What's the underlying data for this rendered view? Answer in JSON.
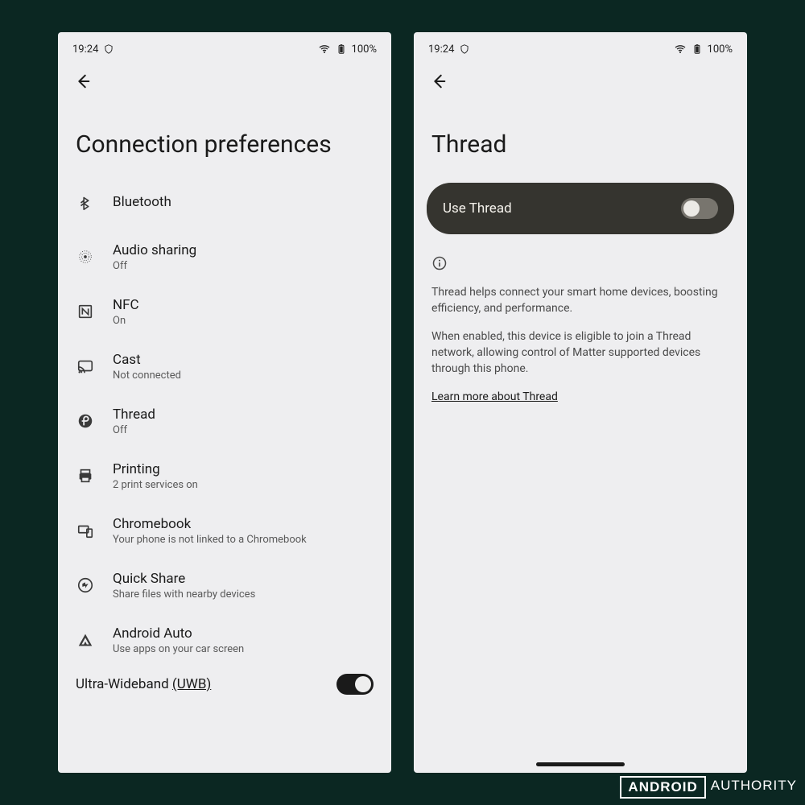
{
  "status": {
    "time": "19:24",
    "battery": "100%"
  },
  "left": {
    "title": "Connection preferences",
    "items": [
      {
        "id": "bluetooth",
        "label": "Bluetooth",
        "sub": ""
      },
      {
        "id": "audio",
        "label": "Audio sharing",
        "sub": "Off"
      },
      {
        "id": "nfc",
        "label": "NFC",
        "sub": "On"
      },
      {
        "id": "cast",
        "label": "Cast",
        "sub": "Not connected"
      },
      {
        "id": "thread",
        "label": "Thread",
        "sub": "Off"
      },
      {
        "id": "printing",
        "label": "Printing",
        "sub": "2 print services on"
      },
      {
        "id": "chromebook",
        "label": "Chromebook",
        "sub": "Your phone is not linked to a Chromebook"
      },
      {
        "id": "quickshare",
        "label": "Quick Share",
        "sub": "Share files with nearby devices"
      },
      {
        "id": "androidauto",
        "label": "Android Auto",
        "sub": "Use apps on your car screen"
      }
    ],
    "uwb_label": "Ultra-Wideband (UWB)",
    "uwb_on": true
  },
  "right": {
    "title": "Thread",
    "pill_label": "Use Thread",
    "pill_on": false,
    "info1": "Thread helps connect your smart home devices, boosting efficiency, and performance.",
    "info2": "When enabled, this device is eligible to join a Thread network, allowing control of Matter supported devices through this phone.",
    "learn": "Learn more about Thread"
  },
  "watermark": {
    "a": "ANDROID",
    "b": "AUTHORITY"
  }
}
